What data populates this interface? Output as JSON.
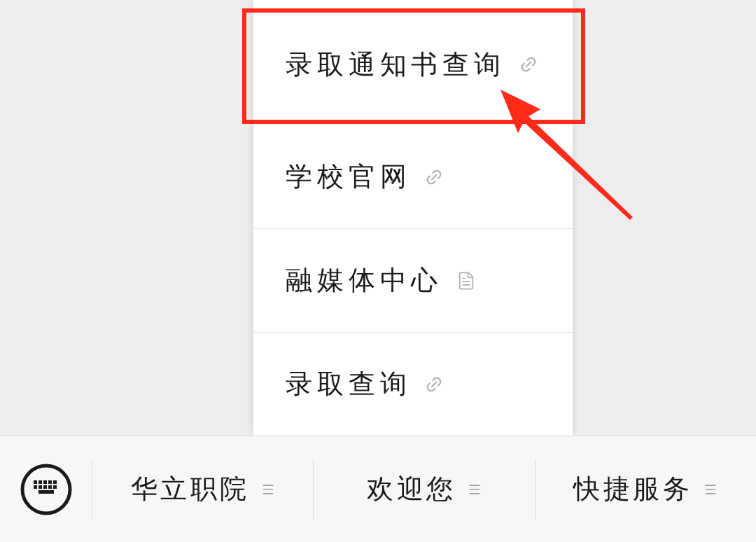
{
  "popup_menu": {
    "items": [
      {
        "label": "录取通知书查询",
        "kind": "link"
      },
      {
        "label": "学校官网",
        "kind": "link"
      },
      {
        "label": "融媒体中心",
        "kind": "article"
      },
      {
        "label": "录取查询",
        "kind": "link"
      }
    ]
  },
  "bottom_menu": {
    "items": [
      {
        "label": "华立职院"
      },
      {
        "label": "欢迎您"
      },
      {
        "label": "快捷服务"
      }
    ]
  }
}
